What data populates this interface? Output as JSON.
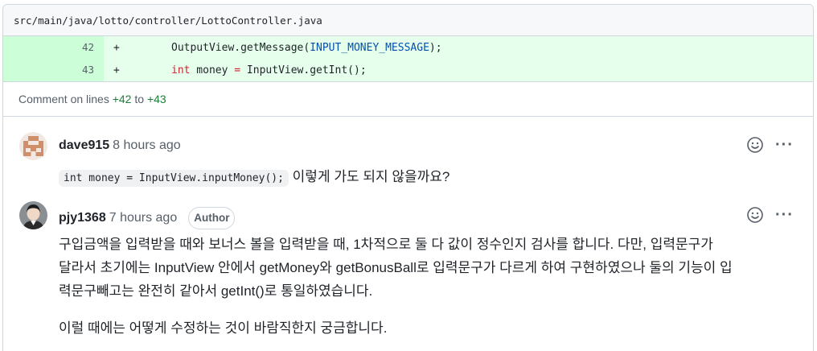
{
  "file": {
    "path": "src/main/java/lotto/controller/LottoController.java"
  },
  "diff": {
    "lines": [
      {
        "number": "42",
        "marker": "+",
        "pre": "OutputView.getMessage(",
        "const": "INPUT_MONEY_MESSAGE",
        "post": ");"
      },
      {
        "number": "43",
        "marker": "+",
        "kw": "int",
        "mid": " money ",
        "op": "=",
        "rest": " InputView.getInt();"
      }
    ]
  },
  "comment_on": {
    "prefix": "Comment on lines",
    "from": "+42",
    "to_word": "to",
    "to": "+43"
  },
  "comments": [
    {
      "author": "dave915",
      "time": "8 hours ago",
      "code": "int money = InputView.inputMoney();",
      "text": "이렇게 가도 되지 않을까요?"
    },
    {
      "author": "pjy1368",
      "time": "7 hours ago",
      "badge": "Author",
      "line1": "구입금액을 입력받을 때와 보너스 볼을 입력받을 때, 1차적으로 둘 다 값이 정수인지 검사를 합니다. 다만, 입력문구가",
      "line2": "달라서 초기에는 InputView 안에서 getMoney와 getBonusBall로 입력문구가 다르게 하여 구현하였으나 둘의 기능이 입",
      "line3": "력문구빼고는 완전히 같아서 getInt()로 통일하였습니다.",
      "para2": "이럴 때에는 어떻게 수정하는 것이 바람직한지 궁금합니다."
    }
  ],
  "icons": {
    "emoji": "smiley-icon",
    "more": "kebab-horizontal-icon",
    "more_glyph": "···"
  },
  "colors": {
    "added_bg": "#e6ffec",
    "added_num_bg": "#ccffd8",
    "ref_green": "#1a7f37",
    "const_blue": "#0550ae",
    "keyword_red": "#cf222e"
  }
}
